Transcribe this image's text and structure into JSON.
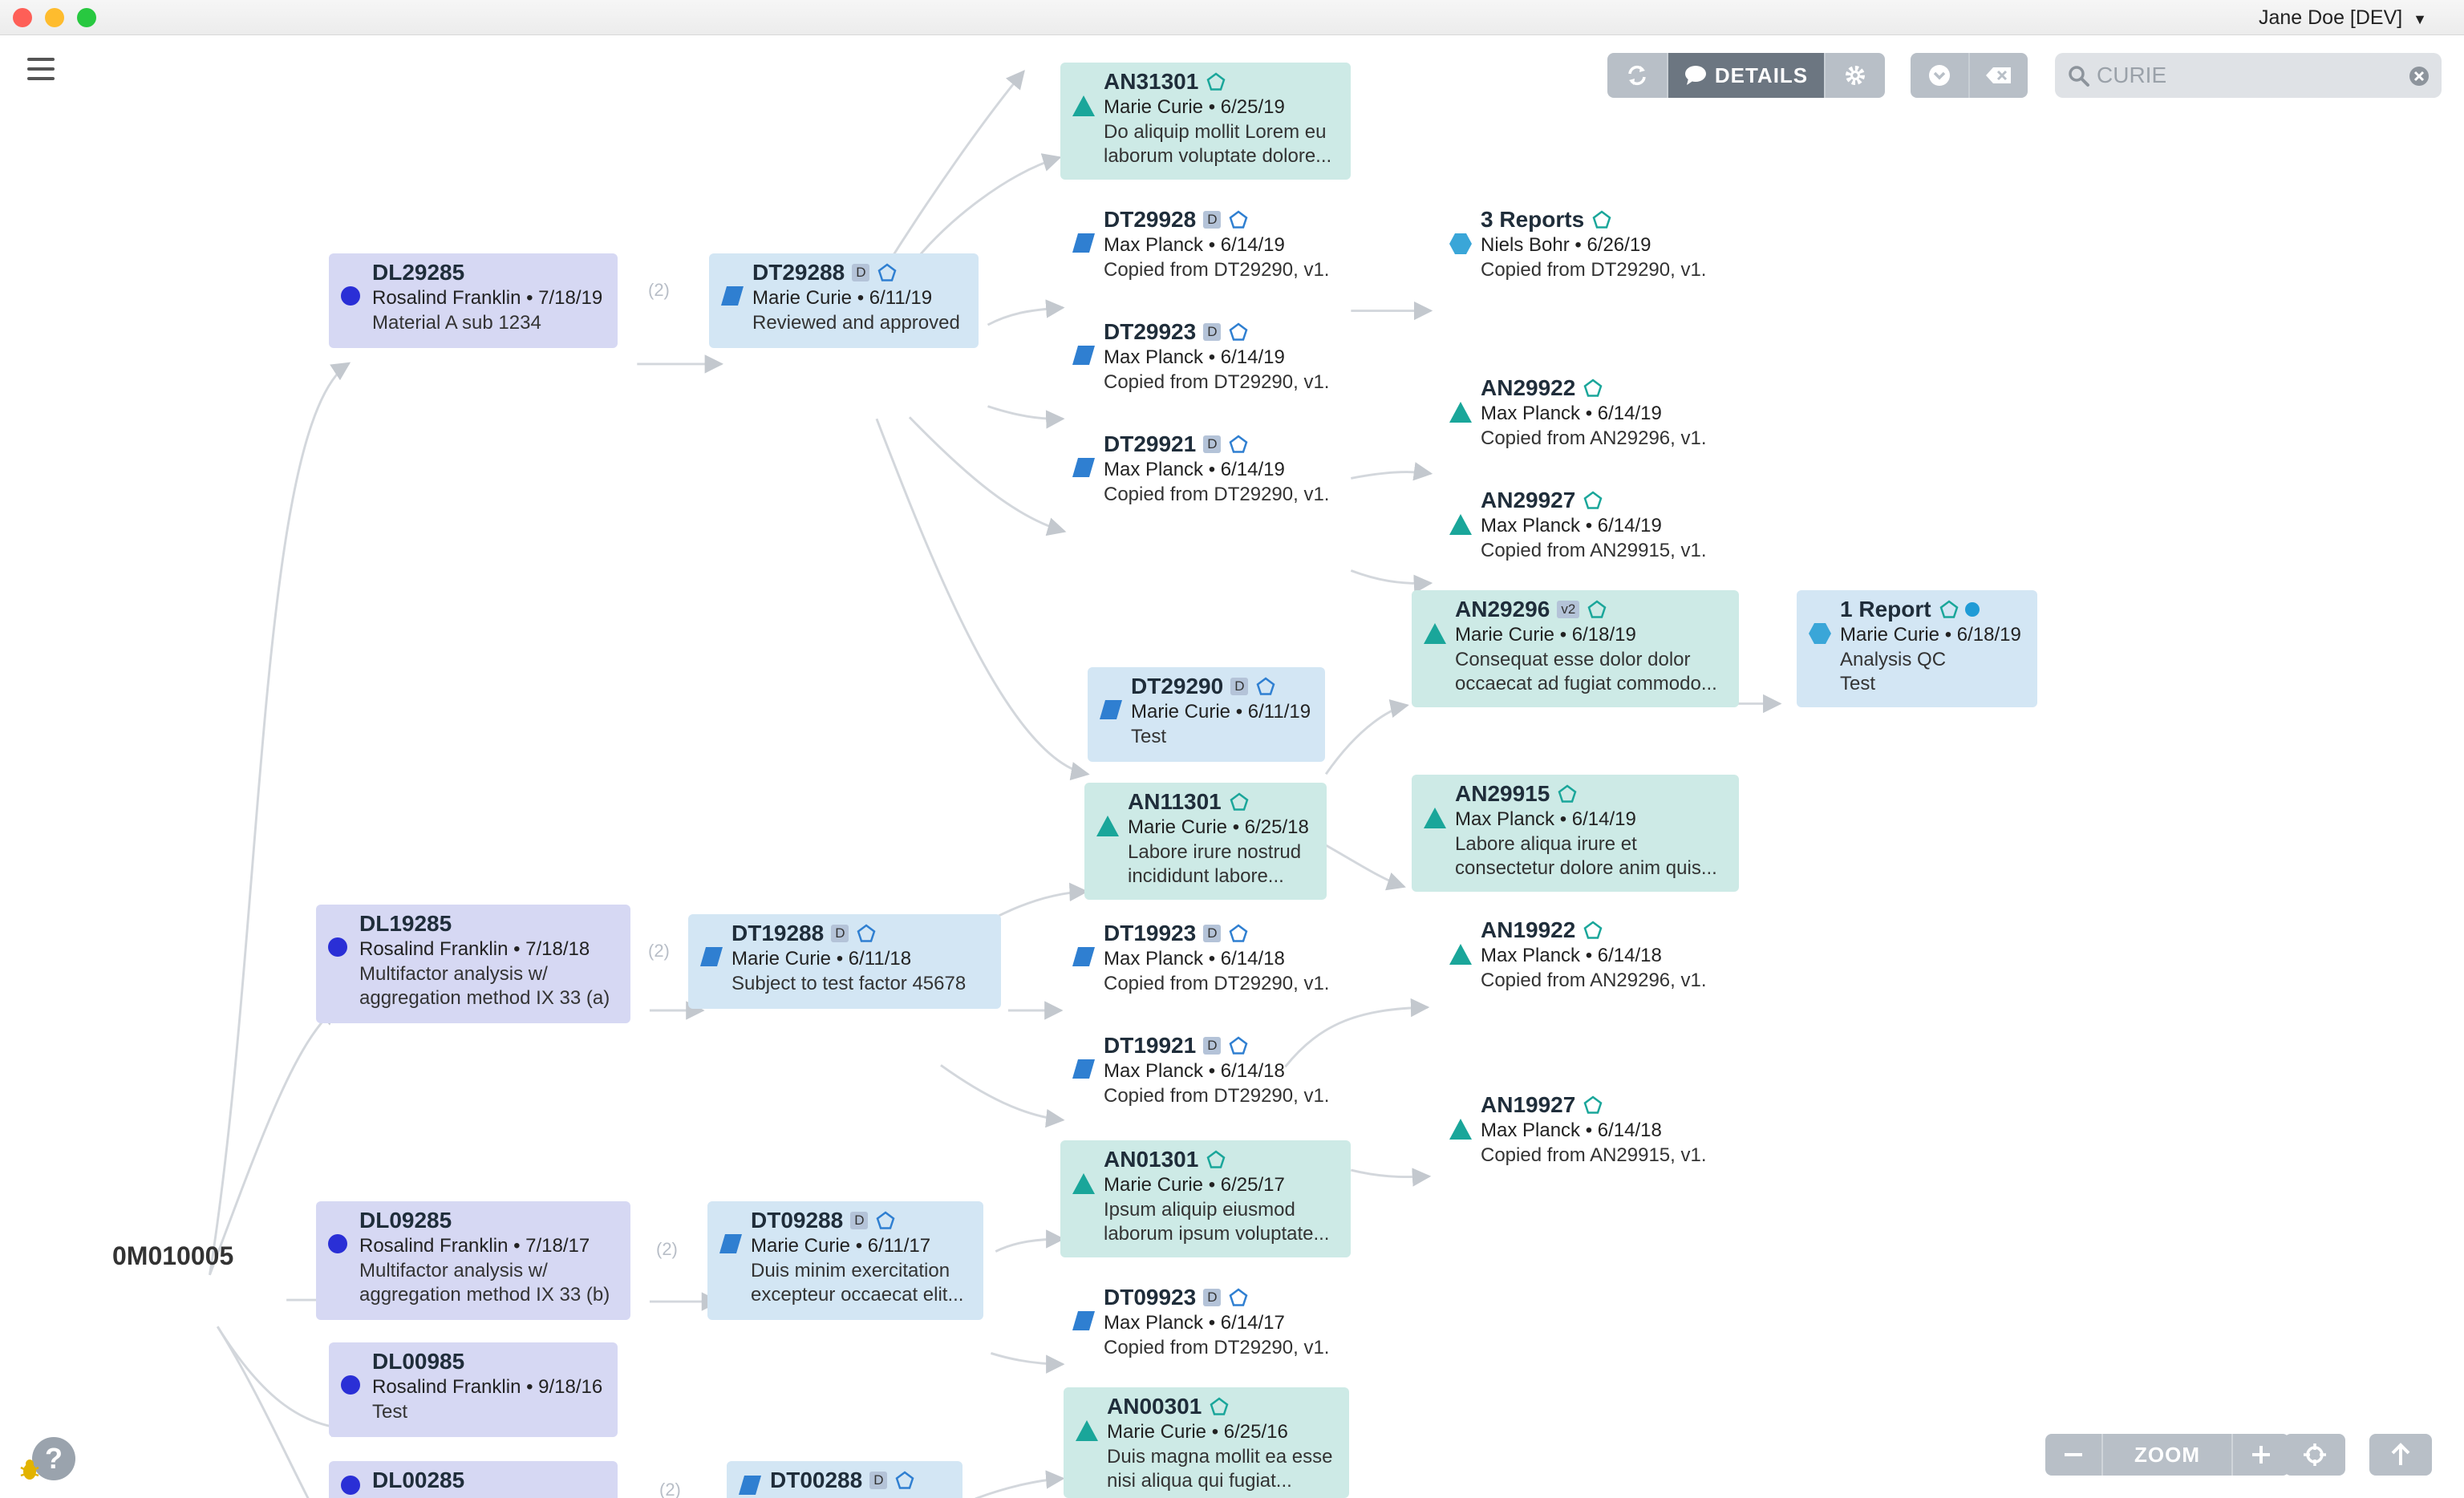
{
  "window": {
    "user_label": "Jane Doe [DEV]"
  },
  "toolbar": {
    "details_label": "DETAILS"
  },
  "search": {
    "value": "CURIE"
  },
  "zoom": {
    "label": "ZOOM"
  },
  "help": {
    "label": "?"
  },
  "graph": {
    "root": "0M010005",
    "edge_labels": [
      "(2)",
      "(2)",
      "(2)",
      "(2)"
    ],
    "nodes": {
      "AN31301": {
        "title": "AN31301",
        "meta": "Marie Curie • 6/25/19",
        "desc": [
          "Do aliquip mollit Lorem eu",
          "laborum voluptate dolore..."
        ]
      },
      "DL29285": {
        "title": "DL29285",
        "meta": "Rosalind Franklin • 7/18/19",
        "desc": [
          "Material A sub 1234"
        ]
      },
      "DT29288": {
        "title": "DT29288",
        "badge": "D",
        "meta": "Marie Curie • 6/11/19",
        "desc": [
          "Reviewed and approved"
        ]
      },
      "DT29928": {
        "title": "DT29928",
        "badge": "D",
        "meta": "Max Planck • 6/14/19",
        "desc": [
          "Copied from DT29290, v1."
        ]
      },
      "R3": {
        "title": "3 Reports",
        "meta": "Niels Bohr • 6/26/19",
        "desc": [
          "Copied from DT29290, v1."
        ]
      },
      "DT29923": {
        "title": "DT29923",
        "badge": "D",
        "meta": "Max Planck • 6/14/19",
        "desc": [
          "Copied from DT29290, v1."
        ]
      },
      "DT29921": {
        "title": "DT29921",
        "badge": "D",
        "meta": "Max Planck • 6/14/19",
        "desc": [
          "Copied from DT29290, v1."
        ]
      },
      "AN29922": {
        "title": "AN29922",
        "meta": "Max Planck • 6/14/19",
        "desc": [
          "Copied from AN29296, v1."
        ]
      },
      "AN29927": {
        "title": "AN29927",
        "meta": "Max Planck • 6/14/19",
        "desc": [
          "Copied from AN29915, v1."
        ]
      },
      "AN29296": {
        "title": "AN29296",
        "badge": "v2",
        "meta": "Marie Curie • 6/18/19",
        "desc": [
          "Consequat esse dolor dolor",
          "occaecat ad fugiat commodo..."
        ]
      },
      "R1": {
        "title": "1 Report",
        "meta": "Marie Curie • 6/18/19",
        "desc": [
          "Analysis QC",
          "Test"
        ]
      },
      "DT29290": {
        "title": "DT29290",
        "badge": "D",
        "meta": "Marie Curie • 6/11/19",
        "desc": [
          "Test"
        ]
      },
      "AN11301": {
        "title": "AN11301",
        "meta": "Marie Curie • 6/25/18",
        "desc": [
          "Labore irure nostrud",
          "incididunt labore..."
        ]
      },
      "AN29915": {
        "title": "AN29915",
        "meta": "Max Planck • 6/14/19",
        "desc": [
          "Labore aliqua irure et",
          "consectetur dolore anim quis..."
        ]
      },
      "DL19285": {
        "title": "DL19285",
        "meta": "Rosalind Franklin • 7/18/18",
        "desc": [
          "Multifactor analysis w/",
          "aggregation method IX 33 (a)"
        ]
      },
      "DT19288": {
        "title": "DT19288",
        "badge": "D",
        "meta": "Marie Curie • 6/11/18",
        "desc": [
          "Subject to test factor 45678"
        ]
      },
      "DT19923": {
        "title": "DT19923",
        "badge": "D",
        "meta": "Max Planck • 6/14/18",
        "desc": [
          "Copied from DT29290, v1."
        ]
      },
      "AN19922": {
        "title": "AN19922",
        "meta": "Max Planck • 6/14/18",
        "desc": [
          "Copied from AN29296, v1."
        ]
      },
      "DT19921": {
        "title": "DT19921",
        "badge": "D",
        "meta": "Max Planck • 6/14/18",
        "desc": [
          "Copied from DT29290, v1."
        ]
      },
      "AN19927": {
        "title": "AN19927",
        "meta": "Max Planck • 6/14/18",
        "desc": [
          "Copied from AN29915, v1."
        ]
      },
      "AN01301": {
        "title": "AN01301",
        "meta": "Marie Curie • 6/25/17",
        "desc": [
          "Ipsum aliquip eiusmod",
          "laborum ipsum voluptate..."
        ]
      },
      "DL09285": {
        "title": "DL09285",
        "meta": "Rosalind Franklin • 7/18/17",
        "desc": [
          "Multifactor analysis w/",
          "aggregation method IX 33 (b)"
        ]
      },
      "DT09288": {
        "title": "DT09288",
        "badge": "D",
        "meta": "Marie Curie • 6/11/17",
        "desc": [
          "Duis minim exercitation",
          "excepteur occaecat elit..."
        ]
      },
      "DT09923": {
        "title": "DT09923",
        "badge": "D",
        "meta": "Max Planck • 6/14/17",
        "desc": [
          "Copied from DT29290, v1."
        ]
      },
      "DL00985": {
        "title": "DL00985",
        "meta": "Rosalind Franklin • 9/18/16",
        "desc": [
          "Test"
        ]
      },
      "AN00301": {
        "title": "AN00301",
        "meta": "Marie Curie • 6/25/16",
        "desc": [
          "Duis magna mollit ea esse",
          "nisi aliqua qui fugiat..."
        ]
      },
      "DL00285": {
        "title": "DL00285"
      },
      "DT00288": {
        "title": "DT00288",
        "badge": "D"
      }
    }
  }
}
